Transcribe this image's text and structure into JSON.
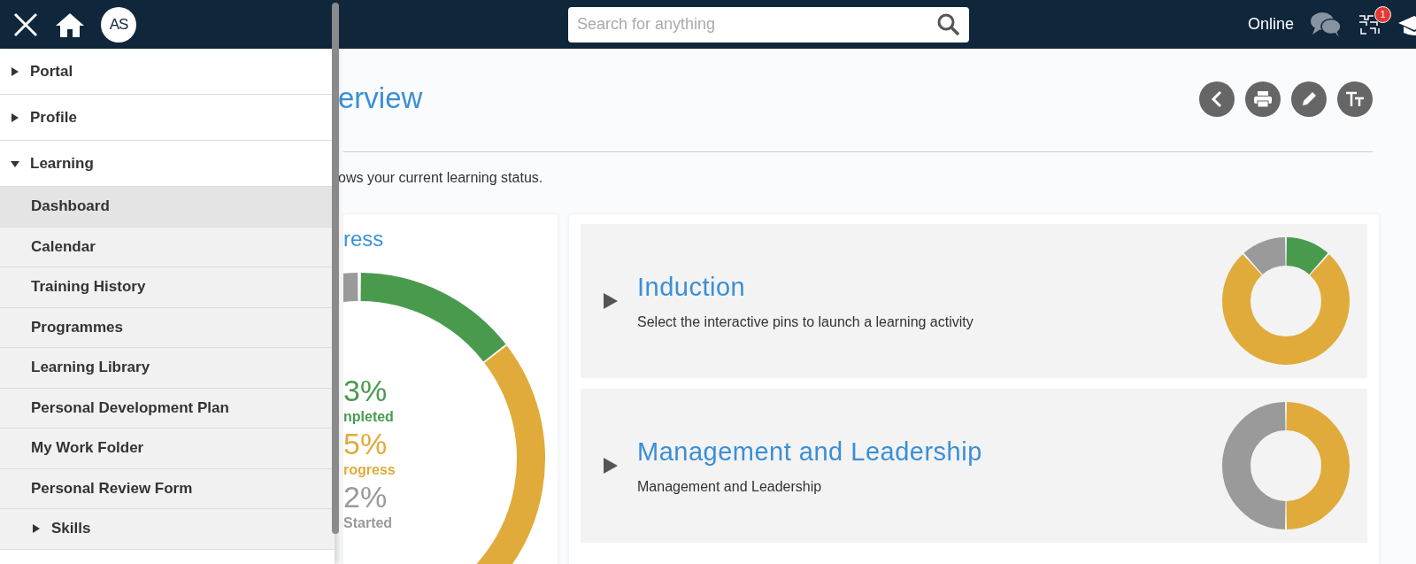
{
  "header": {
    "avatar": "AS",
    "search": {
      "placeholder": "Search for anything"
    },
    "status": "Online",
    "badge": "1"
  },
  "sidebar": {
    "items": [
      {
        "label": "Portal",
        "expanded": false
      },
      {
        "label": "Profile",
        "expanded": false
      },
      {
        "label": "Learning",
        "expanded": true,
        "children": [
          {
            "label": "Dashboard",
            "selected": true
          },
          {
            "label": "Calendar",
            "selected": false
          },
          {
            "label": "Training History",
            "selected": false
          },
          {
            "label": "Programmes",
            "selected": false
          },
          {
            "label": "Learning Library",
            "selected": false
          },
          {
            "label": "Personal Development Plan",
            "selected": false
          },
          {
            "label": "My Work Folder",
            "selected": false
          },
          {
            "label": "Personal Review Form",
            "selected": false
          },
          {
            "label": "Skills",
            "selected": false,
            "expanded": false
          }
        ]
      }
    ]
  },
  "page": {
    "title": "erview",
    "intro": "ows your current learning status.",
    "progress": {
      "title": "ress",
      "stats": [
        {
          "value": "3%",
          "label": "npleted",
          "color": "#4a9a4e"
        },
        {
          "value": "5%",
          "label": "rogress",
          "color": "#e0ab3a"
        },
        {
          "value": "2%",
          "label": "Started",
          "color": "#9a9a9a"
        }
      ]
    },
    "programmes": [
      {
        "title": "Induction",
        "description": "Select the interactive pins to launch a learning activity"
      },
      {
        "title": "Management and Leadership",
        "description": "Management and Leadership"
      }
    ]
  }
}
